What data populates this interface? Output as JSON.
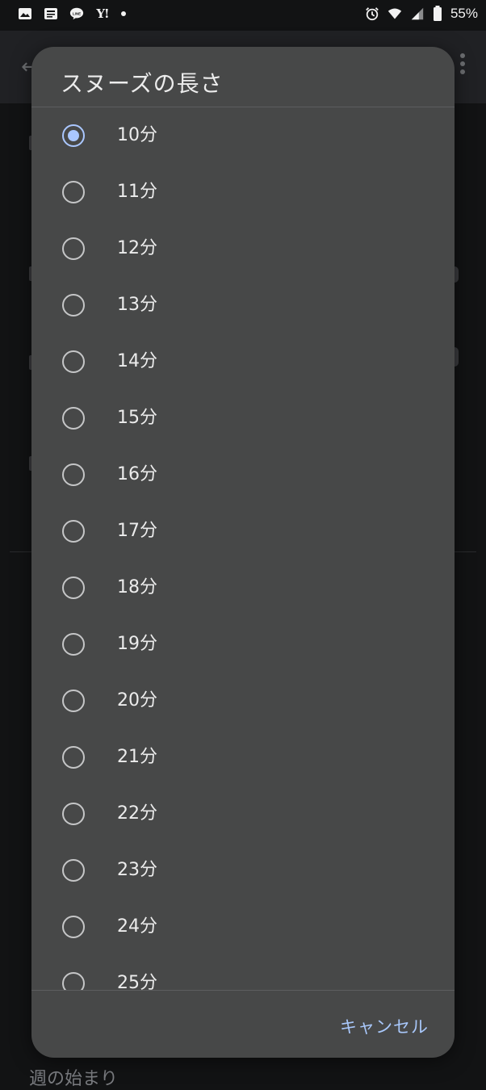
{
  "status_bar": {
    "left_icons": [
      "image-icon",
      "news-icon",
      "line-app-icon",
      "yahoo-icon",
      "notification-dot-icon"
    ],
    "yahoo_text": "Y!",
    "line_text": "LINE",
    "right_icons": [
      "alarm-icon",
      "wifi-icon",
      "signal-icon",
      "battery-icon"
    ],
    "battery_percent": "55%"
  },
  "background_app": {
    "bottom_text": "週の始まり"
  },
  "dialog": {
    "title": "スヌーズの長さ",
    "options": [
      {
        "label": "10分",
        "selected": true
      },
      {
        "label": "11分",
        "selected": false
      },
      {
        "label": "12分",
        "selected": false
      },
      {
        "label": "13分",
        "selected": false
      },
      {
        "label": "14分",
        "selected": false
      },
      {
        "label": "15分",
        "selected": false
      },
      {
        "label": "16分",
        "selected": false
      },
      {
        "label": "17分",
        "selected": false
      },
      {
        "label": "18分",
        "selected": false
      },
      {
        "label": "19分",
        "selected": false
      },
      {
        "label": "20分",
        "selected": false
      },
      {
        "label": "21分",
        "selected": false
      },
      {
        "label": "22分",
        "selected": false
      },
      {
        "label": "23分",
        "selected": false
      },
      {
        "label": "24分",
        "selected": false
      },
      {
        "label": "25分",
        "selected": false
      }
    ],
    "cancel_label": "キャンセル"
  },
  "colors": {
    "accent": "#aac7ff",
    "dialog_bg": "#474848",
    "screen_bg": "#121314"
  }
}
